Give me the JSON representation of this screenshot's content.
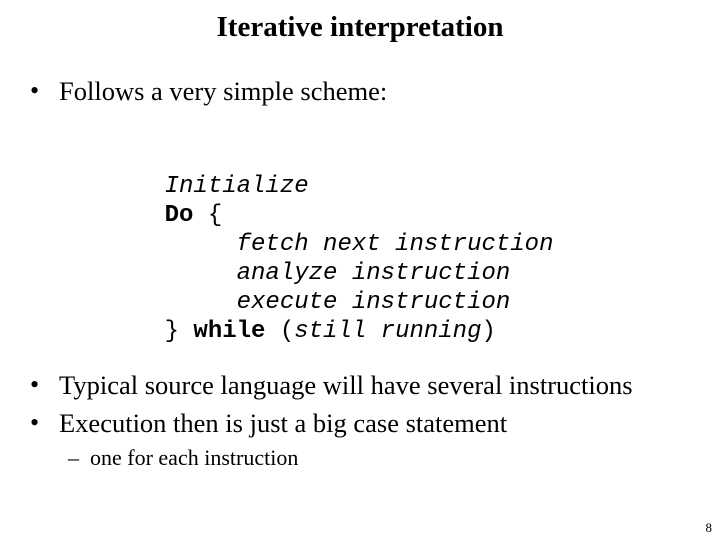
{
  "slide": {
    "title": "Iterative interpretation",
    "bullet_glyph": "•",
    "sub_bullet_glyph": "–",
    "bullets": [
      {
        "text": "Follows a very simple scheme:"
      },
      {
        "text": "Typical source language will have several instructions"
      },
      {
        "text": "Execution then is just a big case statement",
        "sub_bullets": [
          {
            "text": "one for each instruction"
          }
        ]
      }
    ],
    "code": {
      "line1": {
        "text": "Initialize"
      },
      "line2": {
        "keyword": "Do",
        "rest": " {"
      },
      "line3": {
        "indent": "     ",
        "text": "fetch next instruction"
      },
      "line4": {
        "indent": "     ",
        "text": "analyze instruction"
      },
      "line5": {
        "indent": "     ",
        "text": "execute instruction"
      },
      "line6": {
        "prefix": "} ",
        "keyword": "while",
        "open": " (",
        "condition": "still running",
        "close": ")"
      }
    },
    "page_number": "8"
  }
}
